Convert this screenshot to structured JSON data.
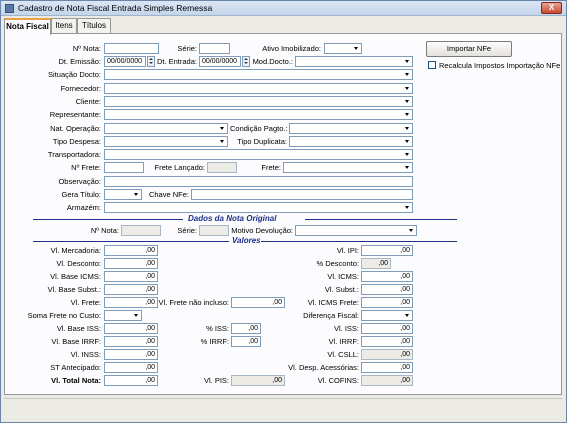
{
  "window": {
    "title": "Cadastro de Nota Fiscal Entrada Simples Remessa",
    "close_glyph": "X"
  },
  "tabs": [
    "Nota Fiscal",
    "Itens",
    "Títulos"
  ],
  "header": {
    "n_nota": "Nº Nota:",
    "serie": "Série:",
    "ativo": "Ativo Imobilizado:",
    "dt_emissao": "Dt. Emissão:",
    "dt_emissao_val": "00/00/0000",
    "dt_entrada": "Dt. Entrada:",
    "dt_entrada_val": "00/00/0000",
    "mod_docto": "Mod.Docto.:",
    "situacao": "Situação Docto:",
    "fornecedor": "Fornecedor:",
    "cliente": "Cliente:",
    "representante": "Representante:",
    "nat_operacao": "Nat. Operação:",
    "condicao_pagto": "Condição Pagto.:",
    "tipo_despesa": "Tipo Despesa:",
    "tipo_duplicata": "Tipo Duplicata:",
    "transportadora": "Transportadora:",
    "n_frete": "Nº Frete:",
    "frete_lancado": "Frete Lançado:",
    "frete": "Frete:",
    "observacao": "Observação:",
    "gera_titulo": "Gera Título:",
    "chave_nfe": "Chave NFe:",
    "armazem": "Armazém:",
    "importar_nfe": "Importar NFe",
    "recalcula": "Recalcula Impostos Importação NFe"
  },
  "dados_original": {
    "title": "Dados da Nota Original",
    "n_nota": "Nº Nota:",
    "serie": "Série:",
    "motivo": "Motivo Devolução:"
  },
  "valores": {
    "title": "Valores",
    "left": [
      {
        "label": "Vl. Mercadoria:",
        "value": ",00"
      },
      {
        "label": "Vl. Desconto:",
        "value": ",00"
      },
      {
        "label": "Vl. Base ICMS:",
        "value": ",00"
      },
      {
        "label": "Vl. Base Subst.:",
        "value": ",00"
      },
      {
        "label": "Vl. Frete:",
        "value": ",00"
      },
      {
        "label": "Soma Frete no Custo:",
        "value": ""
      },
      {
        "label": "Vl. Base ISS:",
        "value": ",00"
      },
      {
        "label": "Vl. Base IRRF:",
        "value": ",00"
      },
      {
        "label": "Vl. INSS:",
        "value": ",00"
      },
      {
        "label": "ST Antecipado:",
        "value": ",00"
      },
      {
        "label": "Vl. Total Nota:",
        "value": ",00"
      }
    ],
    "middle": [
      {
        "label": "Vl. Frete não incluso:",
        "value": ",00"
      },
      {
        "label": "% ISS:",
        "value": ",00"
      },
      {
        "label": "% IRRF:",
        "value": ",00"
      },
      {
        "label": "Vl. PIS:",
        "value": ",00"
      }
    ],
    "right": [
      {
        "label": "Vl. IPI:",
        "value": ",00"
      },
      {
        "label": "% Desconto:",
        "value": ",00"
      },
      {
        "label": "Vl. ICMS:",
        "value": ",00"
      },
      {
        "label": "Vl. Subst.:",
        "value": ",00"
      },
      {
        "label": "Vl. ICMS Frete:",
        "value": ",00"
      },
      {
        "label": "Diferença Fiscal:",
        "value": ""
      },
      {
        "label": "Vl. ISS:",
        "value": ",00"
      },
      {
        "label": "Vl. IRRF:",
        "value": ",00"
      },
      {
        "label": "Vl. CSLL:",
        "value": ",00"
      },
      {
        "label": "Vl. Desp. Acessórias:",
        "value": ",00"
      },
      {
        "label": "Vl. COFINS:",
        "value": ",00"
      }
    ]
  }
}
